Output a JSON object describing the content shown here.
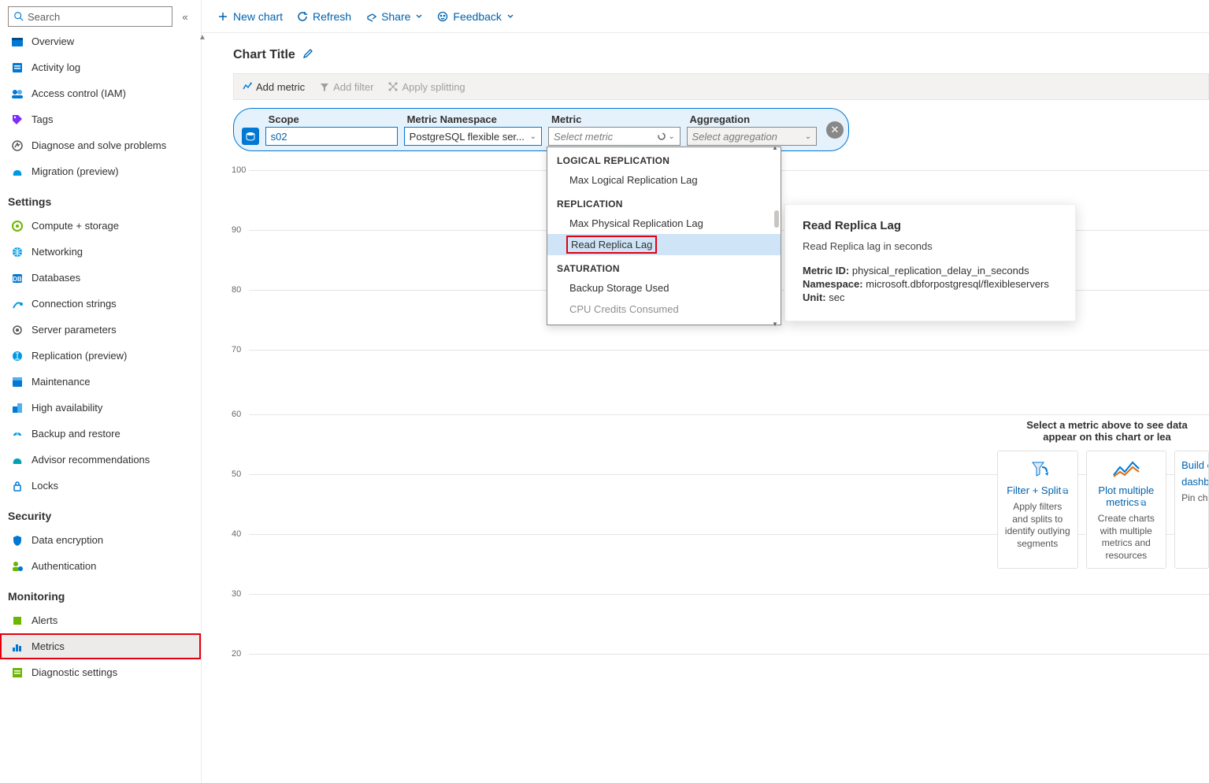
{
  "search": {
    "placeholder": "Search"
  },
  "nav": {
    "top": [
      {
        "label": "Overview"
      },
      {
        "label": "Activity log"
      },
      {
        "label": "Access control (IAM)"
      },
      {
        "label": "Tags"
      },
      {
        "label": "Diagnose and solve problems"
      },
      {
        "label": "Migration (preview)"
      }
    ],
    "settings_head": "Settings",
    "settings": [
      {
        "label": "Compute + storage"
      },
      {
        "label": "Networking"
      },
      {
        "label": "Databases"
      },
      {
        "label": "Connection strings"
      },
      {
        "label": "Server parameters"
      },
      {
        "label": "Replication (preview)"
      },
      {
        "label": "Maintenance"
      },
      {
        "label": "High availability"
      },
      {
        "label": "Backup and restore"
      },
      {
        "label": "Advisor recommendations"
      },
      {
        "label": "Locks"
      }
    ],
    "security_head": "Security",
    "security": [
      {
        "label": "Data encryption"
      },
      {
        "label": "Authentication"
      }
    ],
    "monitoring_head": "Monitoring",
    "monitoring": [
      {
        "label": "Alerts"
      },
      {
        "label": "Metrics"
      },
      {
        "label": "Diagnostic settings"
      }
    ]
  },
  "toolbar": {
    "new_chart": "New chart",
    "refresh": "Refresh",
    "share": "Share",
    "feedback": "Feedback"
  },
  "chart": {
    "title": "Chart Title",
    "add_metric": "Add metric",
    "add_filter": "Add filter",
    "apply_splitting": "Apply splitting"
  },
  "pill": {
    "scope_label": "Scope",
    "scope_value": "s02",
    "ns_label": "Metric Namespace",
    "ns_value": "PostgreSQL flexible ser...",
    "metric_label": "Metric",
    "metric_placeholder": "Select metric",
    "agg_label": "Aggregation",
    "agg_placeholder": "Select aggregation"
  },
  "dropdown": {
    "g1": "LOGICAL REPLICATION",
    "g1_items": [
      "Max Logical Replication Lag"
    ],
    "g2": "REPLICATION",
    "g2_items": [
      "Max Physical Replication Lag",
      "Read Replica Lag"
    ],
    "g3": "SATURATION",
    "g3_items": [
      "Backup Storage Used",
      "CPU Credits Consumed"
    ]
  },
  "tooltip": {
    "title": "Read Replica Lag",
    "desc": "Read Replica lag in seconds",
    "metric_id_label": "Metric ID:",
    "metric_id": "physical_replication_delay_in_seconds",
    "ns_label": "Namespace:",
    "ns": "microsoft.dbforpostgresql/flexibleservers",
    "unit_label": "Unit:",
    "unit": "sec"
  },
  "chart_data": {
    "type": "line",
    "title": "",
    "ylim": [
      20,
      100
    ],
    "yticks": [
      100,
      90,
      80,
      70,
      60,
      50,
      40,
      30,
      20
    ],
    "series": []
  },
  "sugg": {
    "heading": "Select a metric above to see data appear on this chart or lea",
    "cards": [
      {
        "link": "Filter + Split",
        "sub": "Apply filters and splits to identify outlying segments"
      },
      {
        "link": "Plot multiple metrics",
        "sub": "Create charts with multiple metrics and resources"
      },
      {
        "link": "Build cu",
        "sub2": "dashbo",
        "sub": "Pin chart"
      }
    ]
  }
}
